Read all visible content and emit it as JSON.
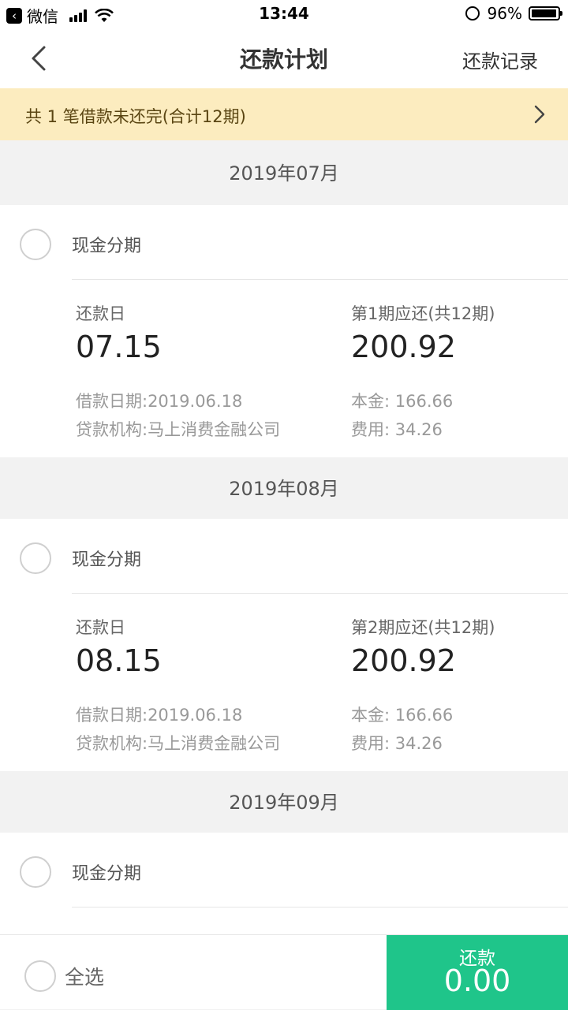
{
  "status_bar": {
    "app_name": "微信",
    "time": "13:44",
    "battery": "96%",
    "battery_level": 0.96
  },
  "nav": {
    "title": "还款计划",
    "right_label": "还款记录"
  },
  "notice": {
    "text": "共 1 笔借款未还完(合计12期)"
  },
  "months": [
    {
      "header": "2019年07月",
      "item": {
        "product": "现金分期",
        "due_label": "还款日",
        "due_date": "07.15",
        "period_label": "第1期应还(共12期)",
        "amount": "200.92",
        "loan_date": "借款日期:2019.06.18",
        "lender": "贷款机构:马上消费金融公司",
        "principal": "本金: 166.66",
        "fee": "费用: 34.26"
      }
    },
    {
      "header": "2019年08月",
      "item": {
        "product": "现金分期",
        "due_label": "还款日",
        "due_date": "08.15",
        "period_label": "第2期应还(共12期)",
        "amount": "200.92",
        "loan_date": "借款日期:2019.06.18",
        "lender": "贷款机构:马上消费金融公司",
        "principal": "本金: 166.66",
        "fee": "费用: 34.26"
      }
    },
    {
      "header": "2019年09月",
      "item": {
        "product": "现金分期"
      }
    }
  ],
  "bottom": {
    "select_all": "全选",
    "pay_label": "还款",
    "pay_amount": "0.00"
  },
  "colors": {
    "accent": "#1fc58a",
    "notice_bg": "#fcecbf"
  }
}
